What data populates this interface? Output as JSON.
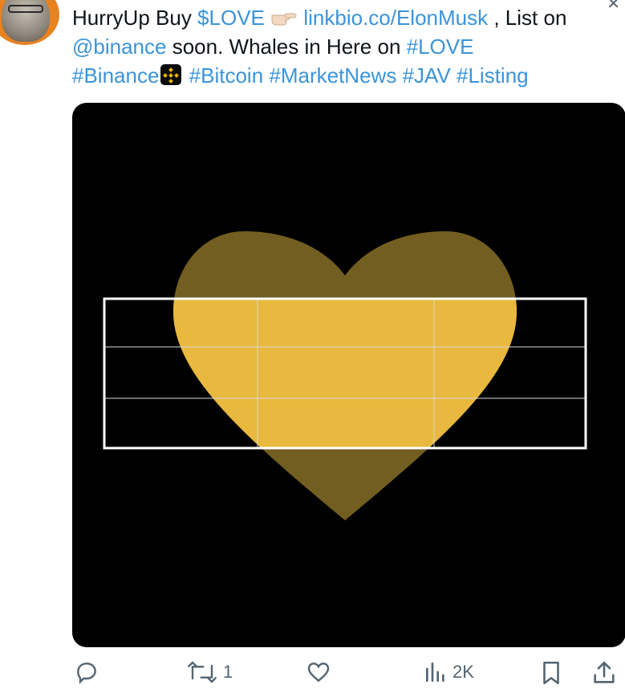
{
  "tweet": {
    "parts_line1": [
      {
        "text": "HurryUp Buy ",
        "link": false
      },
      {
        "text": "$LOVE",
        "link": true
      },
      {
        "text": " ",
        "link": false
      },
      {
        "text": "EMOJI",
        "link": false
      },
      {
        "text": " linkbio.co/ElonMusk",
        "link": true
      },
      {
        "text": " , List on",
        "link": false
      }
    ],
    "line1": {
      "a": "HurryUp Buy ",
      "cashtag": "$LOVE",
      "url": "linkbio.co/ElonMusk",
      "b": " , List on"
    },
    "line2": {
      "mention": "@binance",
      "a": " soon. Whales in Here on ",
      "hashtag": "#LOVE"
    },
    "line3": {
      "h1": "#Binance",
      "h2": "#Bitcoin",
      "h3": "#MarketNews",
      "h4": "#JAV",
      "h5": "#Listing"
    }
  },
  "actions": {
    "reply_count": "",
    "retweet_count": "1",
    "like_count": "",
    "views_count": "2K"
  },
  "colors": {
    "link": "#3b94d9",
    "heart_top": "#735e21",
    "heart_mid": "#e8b93e",
    "icon": "#536471"
  },
  "icons": {
    "more": "more-icon",
    "emoji": "backhand-index-pointing-right-icon",
    "binance": "binance-logo-icon",
    "reply": "reply-icon",
    "retweet": "retweet-icon",
    "like": "heart-icon",
    "views": "views-icon",
    "bookmark": "bookmark-icon",
    "share": "share-icon"
  }
}
